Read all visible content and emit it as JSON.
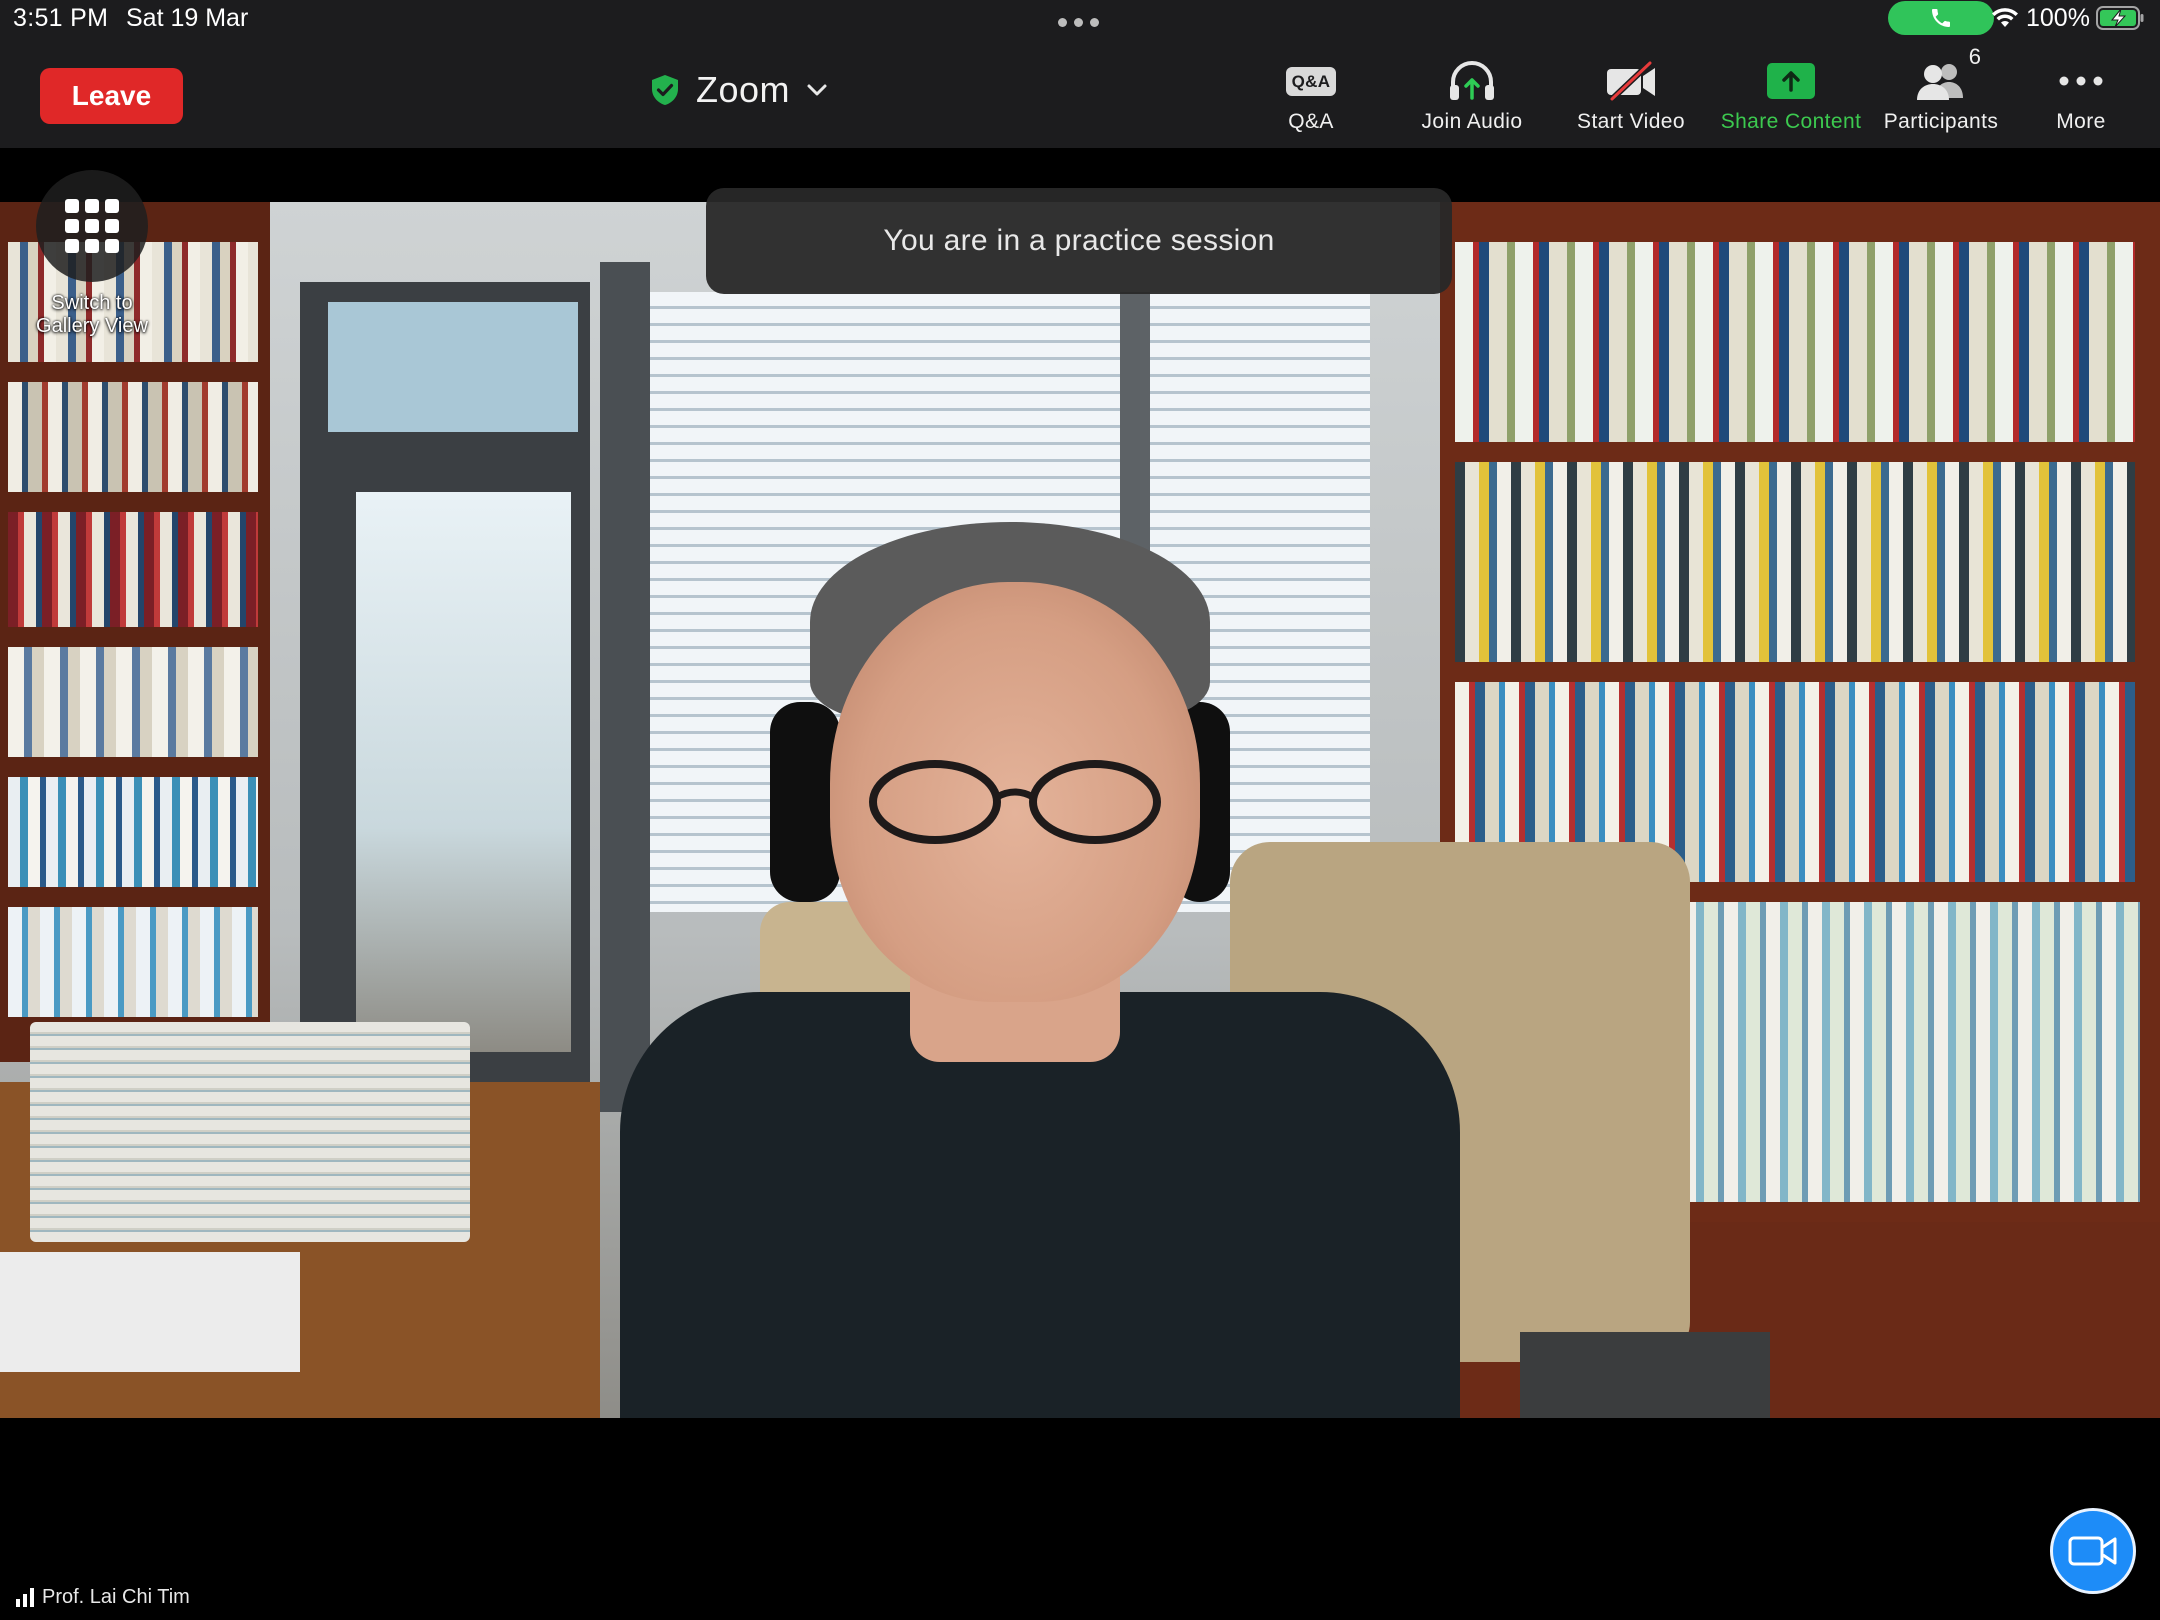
{
  "status_bar": {
    "time": "3:51 PM",
    "date": "Sat 19 Mar",
    "battery": "100%",
    "call_active_color": "#30c45a",
    "icons": [
      "more-dots-icon",
      "phone-icon",
      "wifi-icon",
      "battery-charging-icon"
    ]
  },
  "toolbar": {
    "leave_label": "Leave",
    "leave_color": "#e02828",
    "meeting_title": "Zoom",
    "security_icon": "shield-check-icon",
    "tools": [
      {
        "label": "Q&A",
        "icon_text": "Q&A"
      },
      {
        "label": "Join Audio",
        "icon": "headphones-up-arrow-icon"
      },
      {
        "label": "Start Video",
        "icon": "video-off-icon"
      },
      {
        "label": "Share Content",
        "icon": "share-arrow-icon",
        "color": "#3cc94f"
      },
      {
        "label": "Participants",
        "icon": "participants-icon",
        "count": "6"
      },
      {
        "label": "More",
        "icon": "more-horizontal-icon"
      }
    ]
  },
  "video": {
    "gallery_label": "Switch to Gallery View",
    "toast": "You are in a practice session",
    "participant_name": "Prof. Lai Chi Tim"
  },
  "fab": {
    "icon": "video-camera-icon",
    "color": "#1d8cf8"
  }
}
